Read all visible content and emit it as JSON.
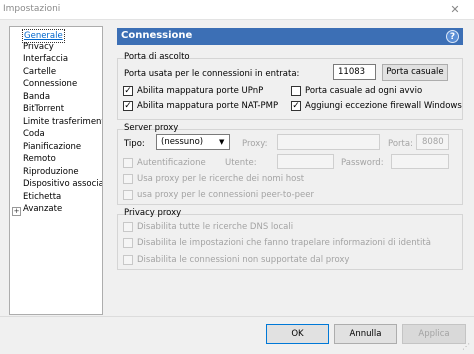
{
  "window": {
    "title": "Impostazioni",
    "close_glyph": "✕"
  },
  "sidebar": {
    "items": [
      {
        "label": "Generale",
        "selected": true
      },
      {
        "label": "Privacy"
      },
      {
        "label": "Interfaccia"
      },
      {
        "label": "Cartelle"
      },
      {
        "label": "Connessione"
      },
      {
        "label": "Banda"
      },
      {
        "label": "BitTorrent"
      },
      {
        "label": "Limite trasferimenti"
      },
      {
        "label": "Coda"
      },
      {
        "label": "Pianificazione"
      },
      {
        "label": "Remoto"
      },
      {
        "label": "Riproduzione"
      },
      {
        "label": "Dispositivo associato"
      },
      {
        "label": "Etichetta"
      },
      {
        "label": "Avanzate",
        "expandable": true
      }
    ],
    "expander_glyph": "+"
  },
  "panel": {
    "title": "Connessione",
    "help_glyph": "?"
  },
  "listen_port": {
    "group_title": "Porta di ascolto",
    "port_label": "Porta usata per le connessioni in entrata:",
    "port_value": "11083",
    "random_port_button": "Porta casuale",
    "upnp": {
      "label": "Abilita mappatura porte UPnP",
      "checked": true
    },
    "random_each_start": {
      "label": "Porta casuale ad ogni avvio",
      "checked": false
    },
    "natpmp": {
      "label": "Abilita mappatura porte NAT-PMP",
      "checked": true
    },
    "firewall": {
      "label": "Aggiungi eccezione firewall Windows",
      "checked": true
    },
    "check_glyph": "✓"
  },
  "proxy": {
    "group_title": "Server proxy",
    "type_label": "Tipo:",
    "type_value": "(nessuno)",
    "proxy_label": "Proxy:",
    "port_label": "Porta:",
    "port_value": "8080",
    "auth_label": "Autentificazione",
    "user_label": "Utente:",
    "password_label": "Password:",
    "hostname_lookup_label": "Usa proxy per le ricerche dei nomi host",
    "p2p_label": "usa proxy per le connessioni peer-to-peer"
  },
  "privacy": {
    "group_title": "Privacy proxy",
    "dns_label": "Disabilita tutte le ricerche DNS locali",
    "identity_label": "Disabilita le impostazioni che fanno trapelare informazioni di identità",
    "unsupported_label": "Disabilita le connessioni non supportate dal proxy"
  },
  "footer": {
    "ok": "OK",
    "cancel": "Annulla",
    "apply": "Applica"
  },
  "colors": {
    "header": "#3c6fb5",
    "link": "#0066cc"
  }
}
